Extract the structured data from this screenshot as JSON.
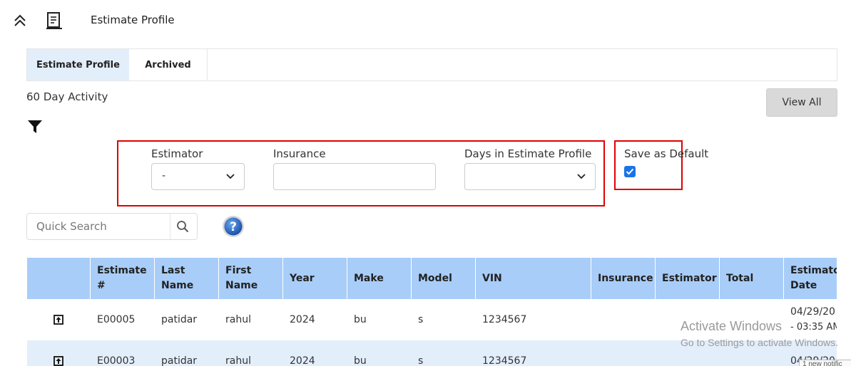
{
  "header": {
    "title": "Estimate Profile"
  },
  "tabs": [
    {
      "label": "Estimate Profile",
      "active": true
    },
    {
      "label": "Archived",
      "active": false
    }
  ],
  "activity": {
    "label": "60 Day Activity",
    "view_all_label": "View All"
  },
  "filters": {
    "estimator_label": "Estimator",
    "estimator_value": "-",
    "insurance_label": "Insurance",
    "insurance_value": "",
    "days_label": "Days in Estimate Profile",
    "days_value": "",
    "save_default_label": "Save as Default",
    "save_default_checked": true
  },
  "search": {
    "placeholder": "Quick Search"
  },
  "table": {
    "headers": [
      "",
      "Estimate #",
      "Last Name",
      "First Name",
      "Year",
      "Make",
      "Model",
      "VIN",
      "Insurance",
      "Estimator",
      "Total",
      "Estimator Date"
    ],
    "rows": [
      {
        "estimate": "E00005",
        "last": "patidar",
        "first": "rahul",
        "year": "2024",
        "make": "bu",
        "model": "s",
        "vin": "1234567",
        "insurance": "",
        "estimator": "",
        "total": "",
        "date": "04/29/20",
        "time": "- 03:35 AM"
      },
      {
        "estimate": "E00003",
        "last": "patidar",
        "first": "rahul",
        "year": "2024",
        "make": "bu",
        "model": "s",
        "vin": "1234567",
        "insurance": "",
        "estimator": "",
        "total": "",
        "date": "04/29/20",
        "time": ""
      }
    ]
  },
  "watermark": {
    "line1": "Activate Windows",
    "line2": "Go to Settings to activate Windows."
  },
  "notification": {
    "text": "1 new notific"
  },
  "colors": {
    "header_bg": "#a8cdf8",
    "active_tab_bg": "#e3eefb",
    "highlight_border": "#e00000",
    "checkbox": "#1a73e8"
  }
}
